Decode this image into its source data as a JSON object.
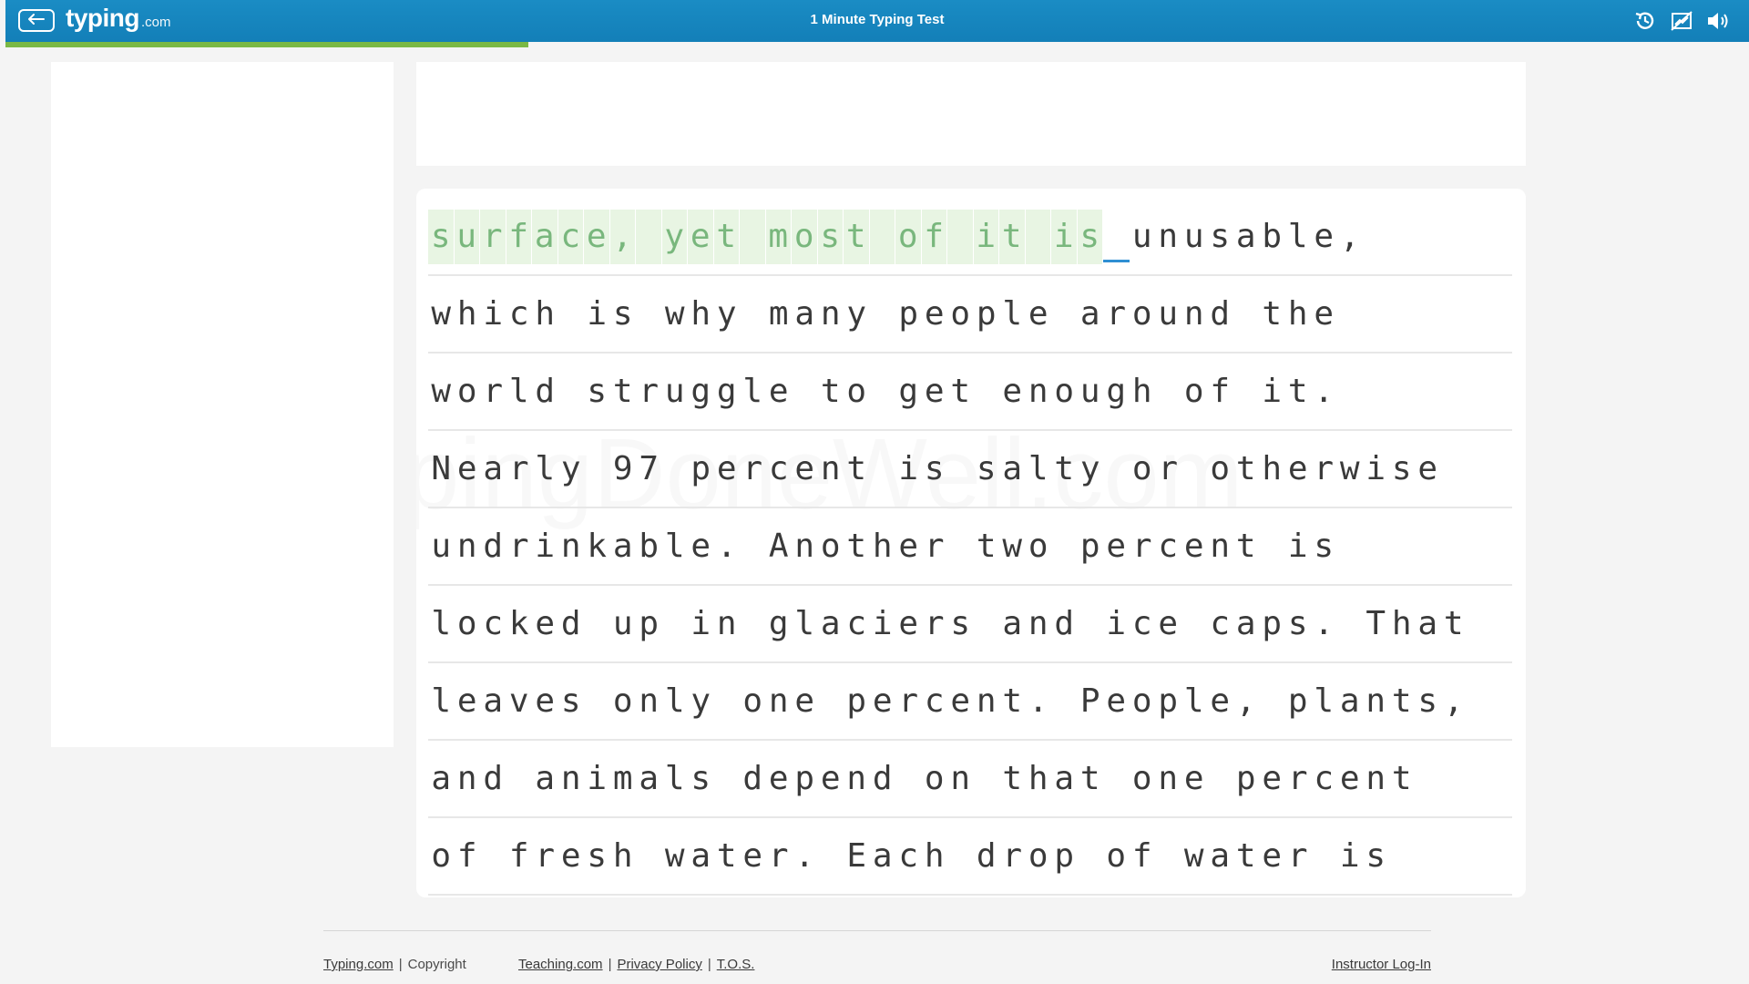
{
  "header": {
    "back_icon": "arrow-left-icon",
    "logo_main": "typing",
    "logo_suffix": ".com",
    "title": "1 Minute Typing Test",
    "icons": [
      "history-icon",
      "hide-graph-icon",
      "volume-icon"
    ],
    "color": "#1a8cc4"
  },
  "progress": {
    "percent": 30,
    "color": "#7ab845"
  },
  "watermark": "TypingDoneWell.com",
  "typing": {
    "typed_line": {
      "completed": "surface, yet most of it is",
      "cursor_char": " ",
      "remaining": "unusable,"
    },
    "lines": [
      "which is why many people around the",
      "world struggle to get enough of it.",
      "Nearly 97 percent is salty or otherwise",
      "undrinkable. Another two percent is",
      "locked up in glaciers and ice caps. That",
      "leaves only one percent. People, plants,",
      "and animals depend on that one percent",
      "of fresh water. Each drop of water is"
    ],
    "completed_color": "#79b77d",
    "completed_bg": "#e8f5e3",
    "cursor_color": "#2f8fd3"
  },
  "footer": {
    "site_link": "Typing.com",
    "copyright": "Copyright",
    "teaching_link": "Teaching.com",
    "privacy_link": "Privacy Policy",
    "tos_link": "T.O.S.",
    "instructor_link": "Instructor Log-In",
    "separator": "|"
  }
}
